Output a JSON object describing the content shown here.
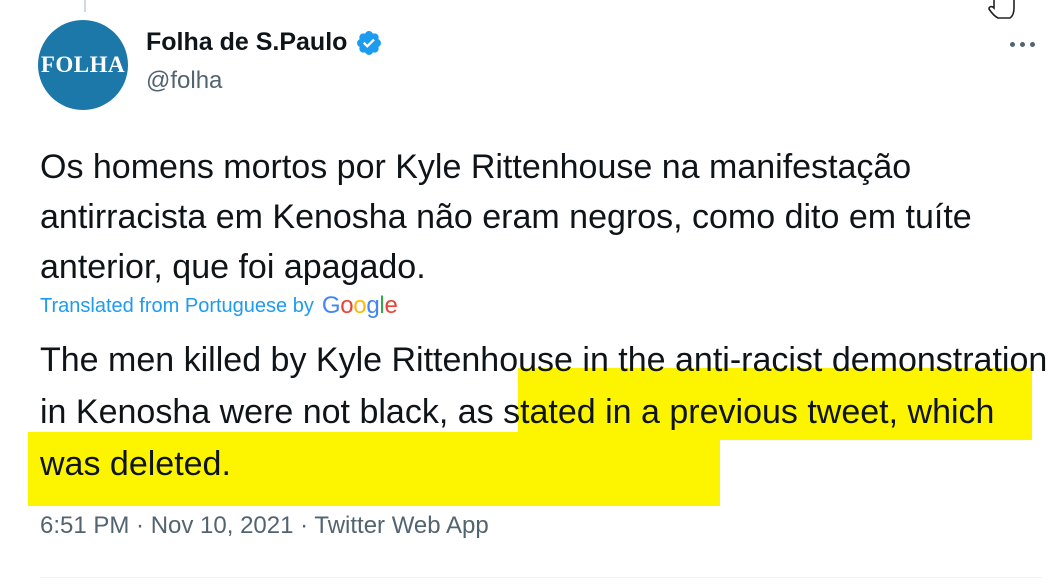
{
  "author": {
    "avatar_text": "FOLHA",
    "display_name": "Folha de S.Paulo",
    "handle": "@folha",
    "verified": true
  },
  "tweet": {
    "original_text": "Os homens mortos por Kyle Rittenhouse na manifestação antirracista em Kenosha não eram negros, como dito em tuíte anterior, que foi apagado.",
    "translation_label": "Translated from Portuguese by",
    "translation_provider": "Google",
    "translated_text_part1": "The men killed by Kyle Rittenhouse in the anti-racist demonstration in Kenosha ",
    "translated_text_highlighted": "were not black, as stated in a previous tweet, which was deleted.",
    "timestamp": "6:51 PM · Nov 10, 2021 · Twitter Web App"
  },
  "colors": {
    "avatar_bg": "#1b78a8",
    "link_blue": "#1d9bf0",
    "highlight": "#fdf500",
    "secondary_text": "#536471"
  },
  "icons": {
    "verified": "verified-badge-icon",
    "more": "more-options-icon",
    "cursor": "hand-cursor-icon"
  }
}
